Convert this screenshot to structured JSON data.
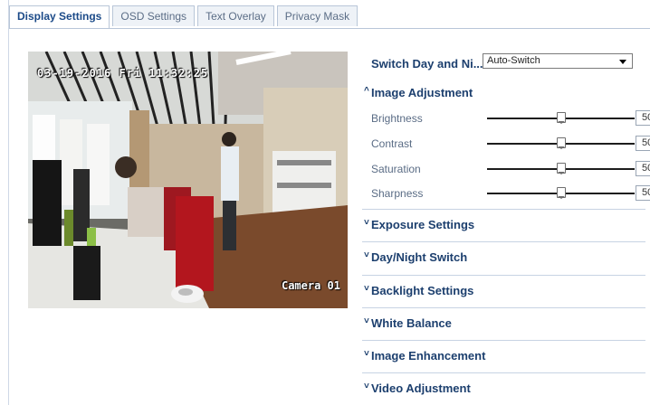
{
  "tabs": [
    {
      "label": "Display Settings",
      "active": true
    },
    {
      "label": "OSD Settings",
      "active": false
    },
    {
      "label": "Text Overlay",
      "active": false
    },
    {
      "label": "Privacy Mask",
      "active": false
    }
  ],
  "preview": {
    "osd_time": "03-19-2016 Fri 11:32:25",
    "osd_name": "Camera 01"
  },
  "day_night": {
    "label": "Switch Day and Ni...",
    "value": "Auto-Switch"
  },
  "image_adjustment": {
    "title": "Image Adjustment",
    "expanded": true,
    "sliders": [
      {
        "name": "Brightness",
        "value": "50",
        "position": 50
      },
      {
        "name": "Contrast",
        "value": "50",
        "position": 50
      },
      {
        "name": "Saturation",
        "value": "50",
        "position": 50
      },
      {
        "name": "Sharpness",
        "value": "50",
        "position": 50
      }
    ]
  },
  "sections": [
    {
      "title": "Exposure Settings"
    },
    {
      "title": "Day/Night Switch"
    },
    {
      "title": "Backlight Settings"
    },
    {
      "title": "White Balance"
    },
    {
      "title": "Image Enhancement"
    },
    {
      "title": "Video Adjustment"
    }
  ],
  "icons": {
    "expanded": "caret-up-icon",
    "collapsed": "caret-down-icon",
    "dropdown": "chevron-down-icon"
  },
  "colors": {
    "accent": "#1c3f6e",
    "tab_active": "#1b4a88"
  }
}
